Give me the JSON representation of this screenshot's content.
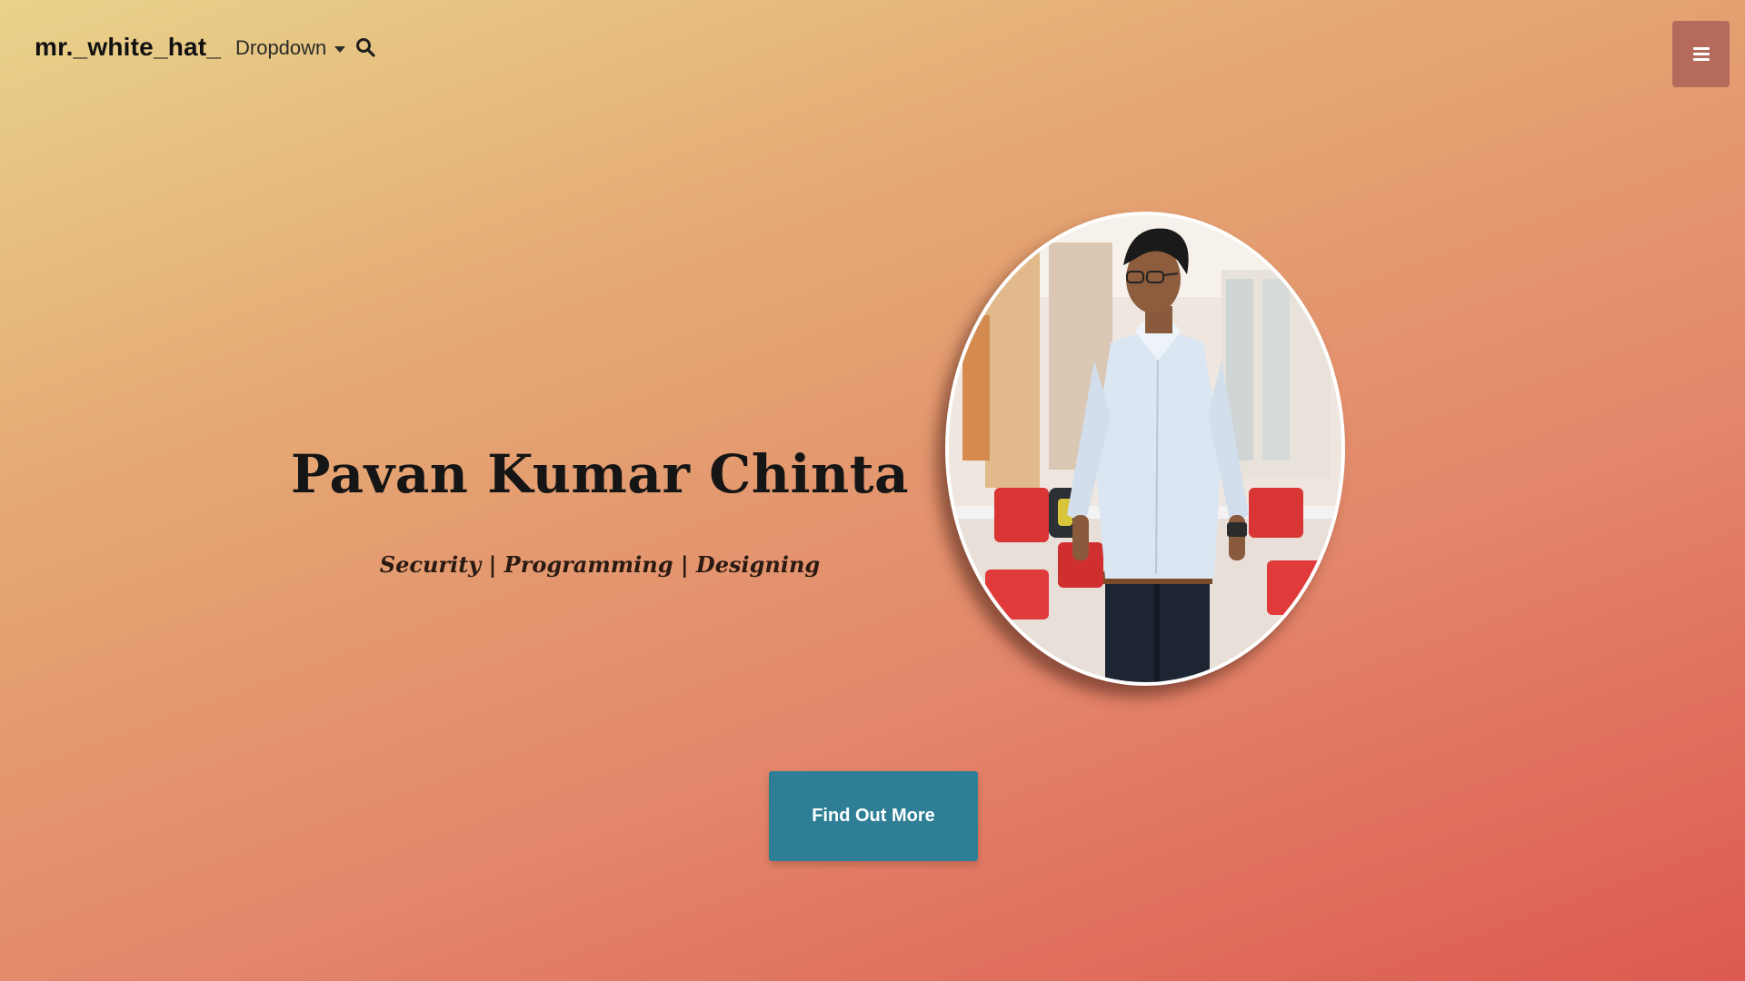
{
  "nav": {
    "brand": "mr._white_hat_",
    "dropdown_label": "Dropdown",
    "search_icon": "search-icon",
    "menu_icon": "hamburger-menu-icon"
  },
  "hero": {
    "name": "Pavan Kumar Chinta",
    "tagline": "Security | Programming | Designing",
    "cta_label": "Find Out More"
  },
  "colors": {
    "gradient_start": "#e8d28a",
    "gradient_end": "#dd5a50",
    "cta_background": "#2e7f96",
    "menu_button_background": "#b56a5c"
  }
}
